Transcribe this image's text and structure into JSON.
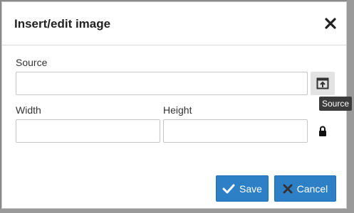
{
  "dialog": {
    "title": "Insert/edit image",
    "close_icon": "close-icon"
  },
  "form": {
    "source_label": "Source",
    "source_value": "",
    "browse_icon": "browse-image-icon",
    "tooltip": "Source",
    "width_label": "Width",
    "width_value": "",
    "height_label": "Height",
    "height_value": "",
    "lock_icon": "lock-icon"
  },
  "buttons": {
    "save_label": "Save",
    "save_icon": "checkmark-icon",
    "cancel_label": "Cancel",
    "cancel_icon": "cross-icon"
  },
  "colors": {
    "primary_button": "#2d80c6",
    "backdrop": "#8a8a8a"
  }
}
